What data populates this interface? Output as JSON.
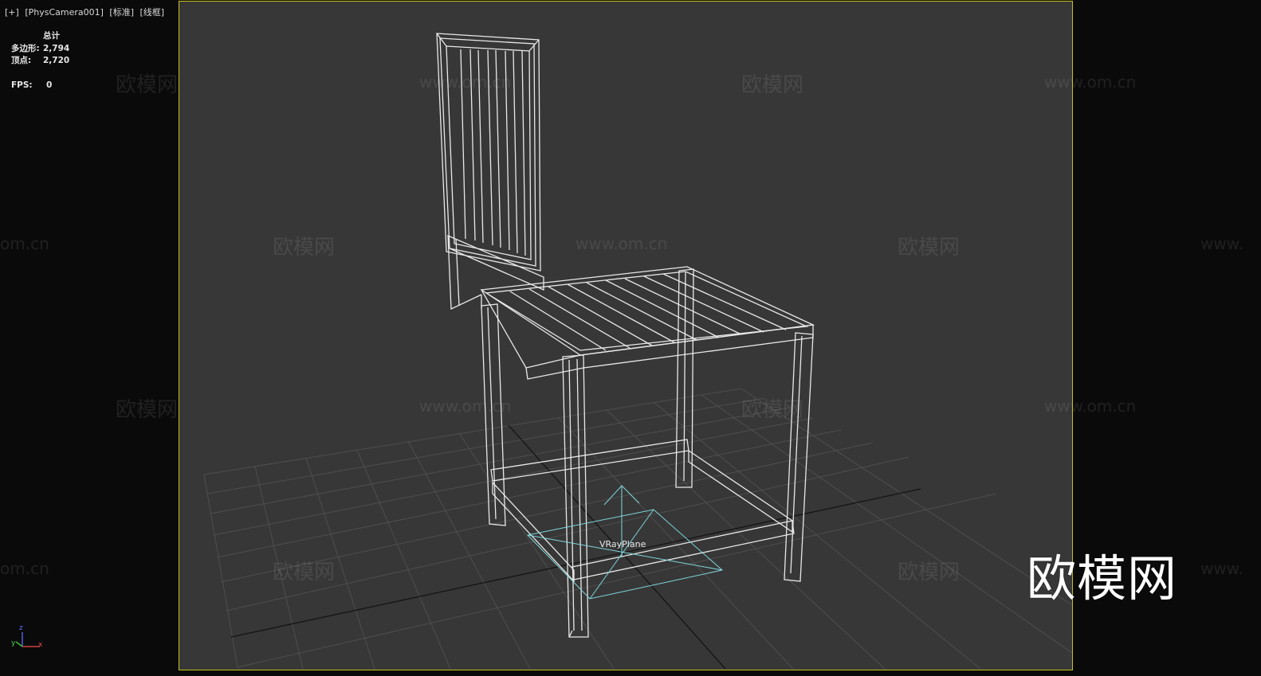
{
  "viewport_label": {
    "plus": "[+]",
    "camera": "[PhysCamera001]",
    "shading": "[标准]",
    "mode": "[线框]"
  },
  "stats": {
    "header": "总计",
    "polys_label": "多边形:",
    "polys_value": "2,794",
    "verts_label": "顶点:",
    "verts_value": "2,720",
    "fps_label": "FPS:",
    "fps_value": "0"
  },
  "object_label": "VRayPlane",
  "axis": {
    "z": "z",
    "x": "x",
    "y": "y"
  },
  "watermarks": {
    "brand": "欧模网",
    "url": "www.om.cn",
    "url_cut_left": "om.cn",
    "url_cut_right": "www."
  },
  "logo": "欧模网",
  "colors": {
    "viewport_bg": "#373737",
    "active_border": "#c8c020",
    "wireframe": "#e8e8e8",
    "plane": "#7fd6dc",
    "grid": "#4e4e4e"
  }
}
